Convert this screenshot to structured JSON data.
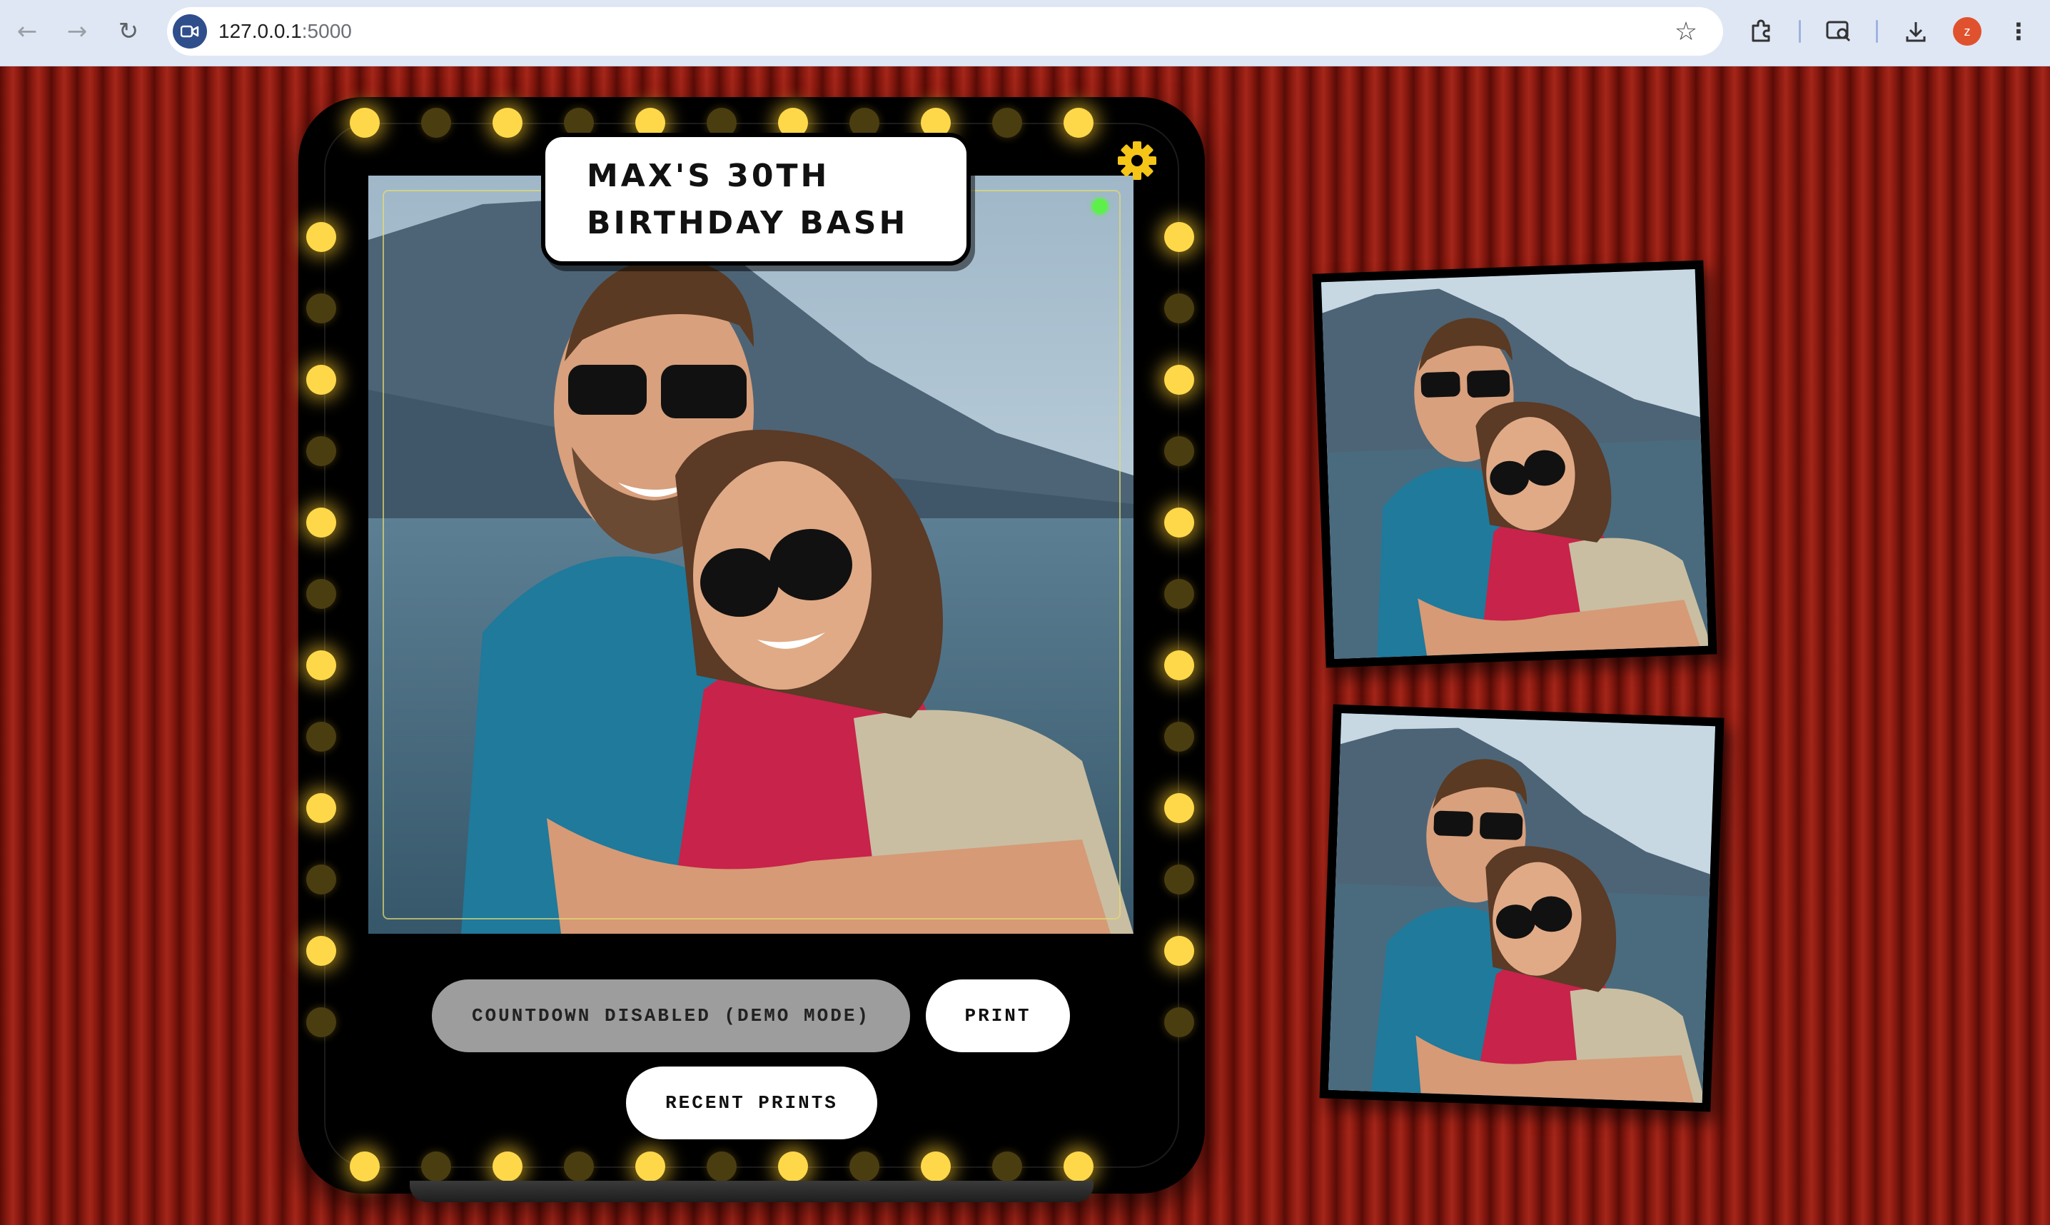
{
  "browser": {
    "url_host": "127.0.0.1",
    "url_port": ":5000",
    "profile_initial": "Z",
    "icons": {
      "back": "arrow-left-icon",
      "forward": "arrow-right-icon",
      "reload": "reload-icon",
      "site": "video-camera-icon",
      "bookmark": "star-icon",
      "extensions": "puzzle-icon",
      "tab_search": "tab-search-icon",
      "downloads": "download-icon",
      "menu": "kebab-menu-icon"
    }
  },
  "booth": {
    "title_line1": "MAX'S 30TH",
    "title_line2": "BIRTHDAY BASH",
    "settings_icon": "gear-icon",
    "camera_status": "live",
    "colors": {
      "bulb": "#ffd84a",
      "gear": "#f5c518",
      "status": "#5ef04a",
      "curtain": "#8a1a10"
    }
  },
  "controls": {
    "countdown_label": "COUNTDOWN DISABLED (DEMO MODE)",
    "print_label": "PRINT",
    "recent_label": "RECENT PRINTS"
  },
  "prints": [
    {
      "id": "print-1"
    },
    {
      "id": "print-2"
    }
  ]
}
